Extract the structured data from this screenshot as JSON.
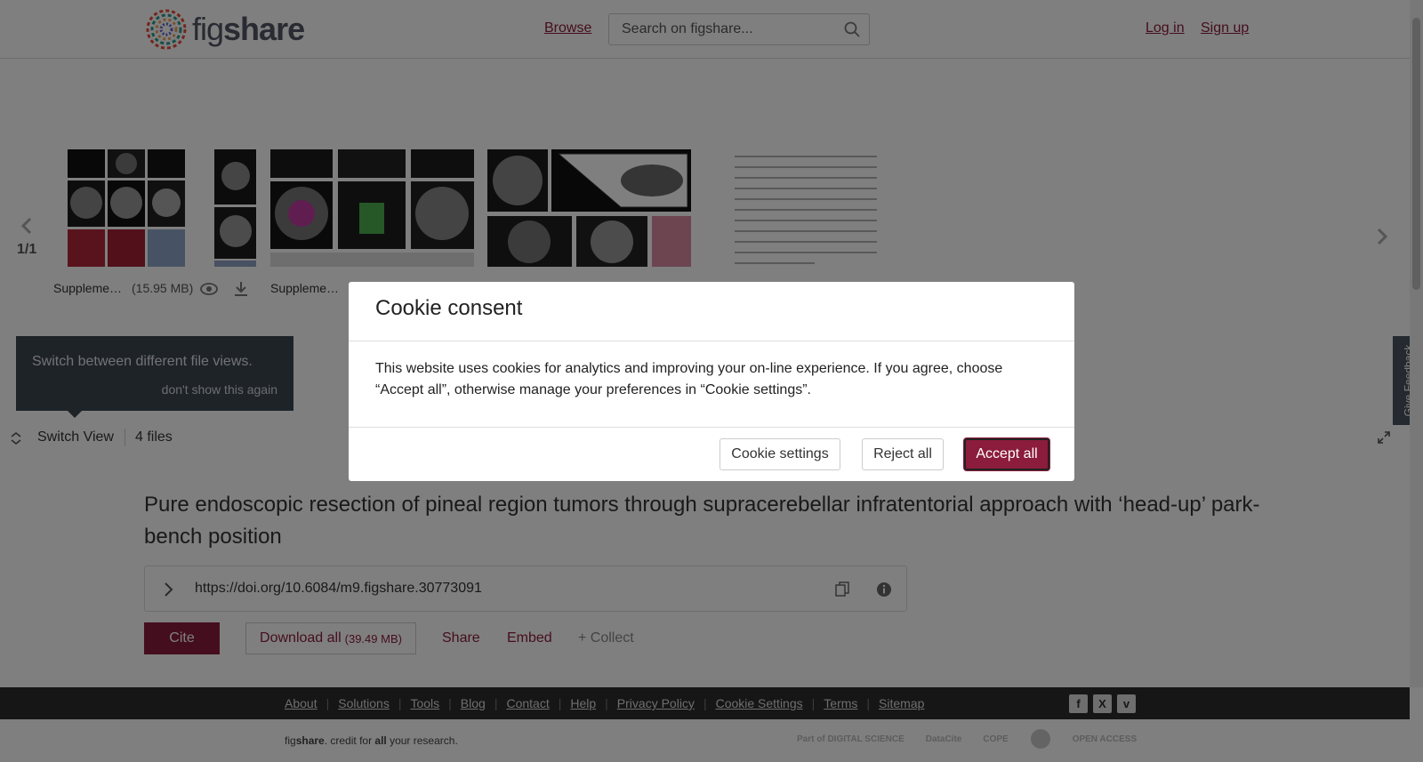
{
  "header": {
    "logo_text_light": "fig",
    "logo_text_bold": "share",
    "browse": "Browse",
    "search_placeholder": "Search on figshare...",
    "login": "Log in",
    "signup": "Sign up"
  },
  "carousel": {
    "page_count": "1/1",
    "files": [
      {
        "label": "Suppleme…",
        "size": "(15.95 MB)"
      },
      {
        "label": "Suppleme…",
        "size": ""
      }
    ],
    "tooltip_text": "Switch between different file views.",
    "tooltip_dismiss": "don't show this again",
    "switch_view": "Switch View",
    "files_count": "4 files"
  },
  "main": {
    "title": "Pure endoscopic resection of pineal region tumors through supracerebellar infratentorial approach with ‘head-up’ park-bench position",
    "doi": "https://doi.org/10.6084/m9.figshare.30773091",
    "cite": "Cite",
    "download_all": "Download all",
    "download_size": "(39.49 MB)",
    "share": "Share",
    "embed": "Embed",
    "collect": "+ Collect"
  },
  "footer": {
    "links": [
      "About",
      "Solutions",
      "Tools",
      "Blog",
      "Contact",
      "Help",
      "Privacy Policy",
      "Cookie Settings",
      "Terms",
      "Sitemap"
    ],
    "credit_pre": "fig",
    "credit_bold": "share",
    "credit_mid": ". credit for ",
    "credit_all": "all",
    "credit_post": " your research.",
    "partners": [
      "Part of DIGITAL SCIENCE",
      "DataCite",
      "COPE",
      "",
      "OPEN ACCESS"
    ]
  },
  "feedback": "Give Feedback",
  "modal": {
    "title": "Cookie consent",
    "body": "This website uses cookies for analytics and improving your on-line experience. If you agree, choose “Accept all”, otherwise manage your preferences in “Cookie settings”.",
    "cookie_settings": "Cookie settings",
    "reject_all": "Reject all",
    "accept_all": "Accept all"
  },
  "colors": {
    "brand": "#8b1c3c",
    "footer_bg": "#2c2c2c"
  }
}
